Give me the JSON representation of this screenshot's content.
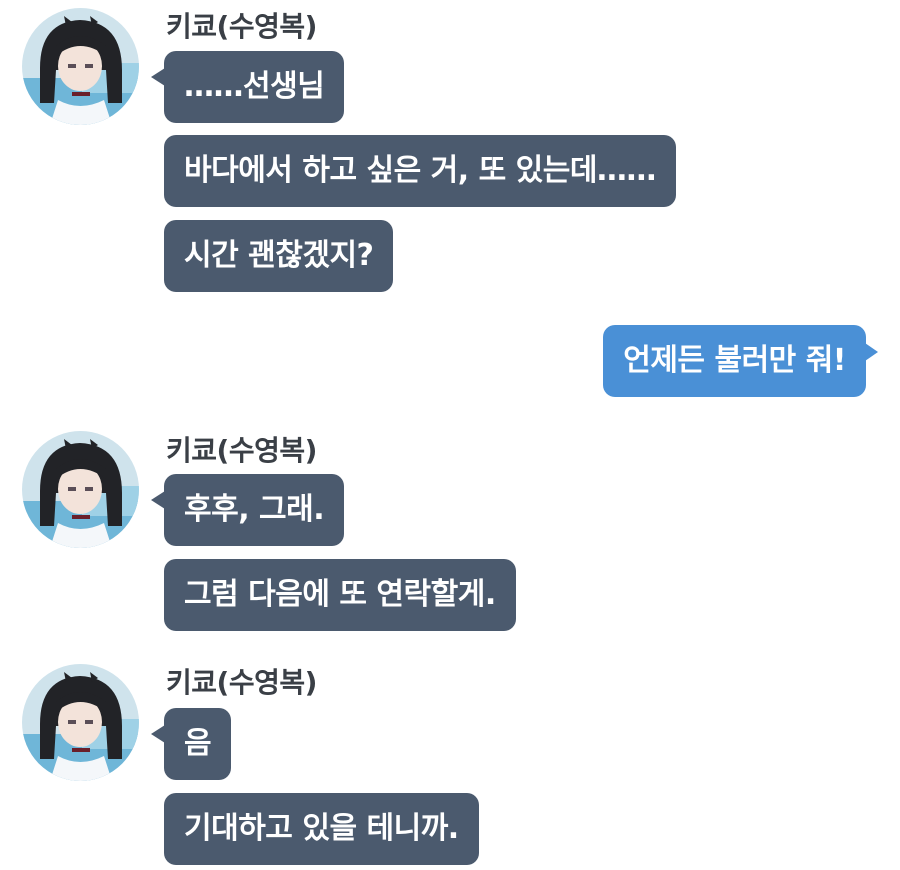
{
  "groups": [
    {
      "sender": "키쿄(수영복)",
      "messages": [
        "……선생님",
        "바다에서 하고 싶은 거, 또 있는데……",
        "시간 괜찮겠지?"
      ]
    },
    {
      "sender": "키쿄(수영복)",
      "messages": [
        "후후, 그래.",
        "그럼 다음에 또 연락할게."
      ]
    },
    {
      "sender": "키쿄(수영복)",
      "messages": [
        "음",
        "기대하고 있을 테니까."
      ]
    }
  ],
  "reply": {
    "text": "언제든 불러만 줘!"
  },
  "colors": {
    "incoming_bubble": "#4b5a6e",
    "outgoing_bubble": "#4a90d6"
  }
}
